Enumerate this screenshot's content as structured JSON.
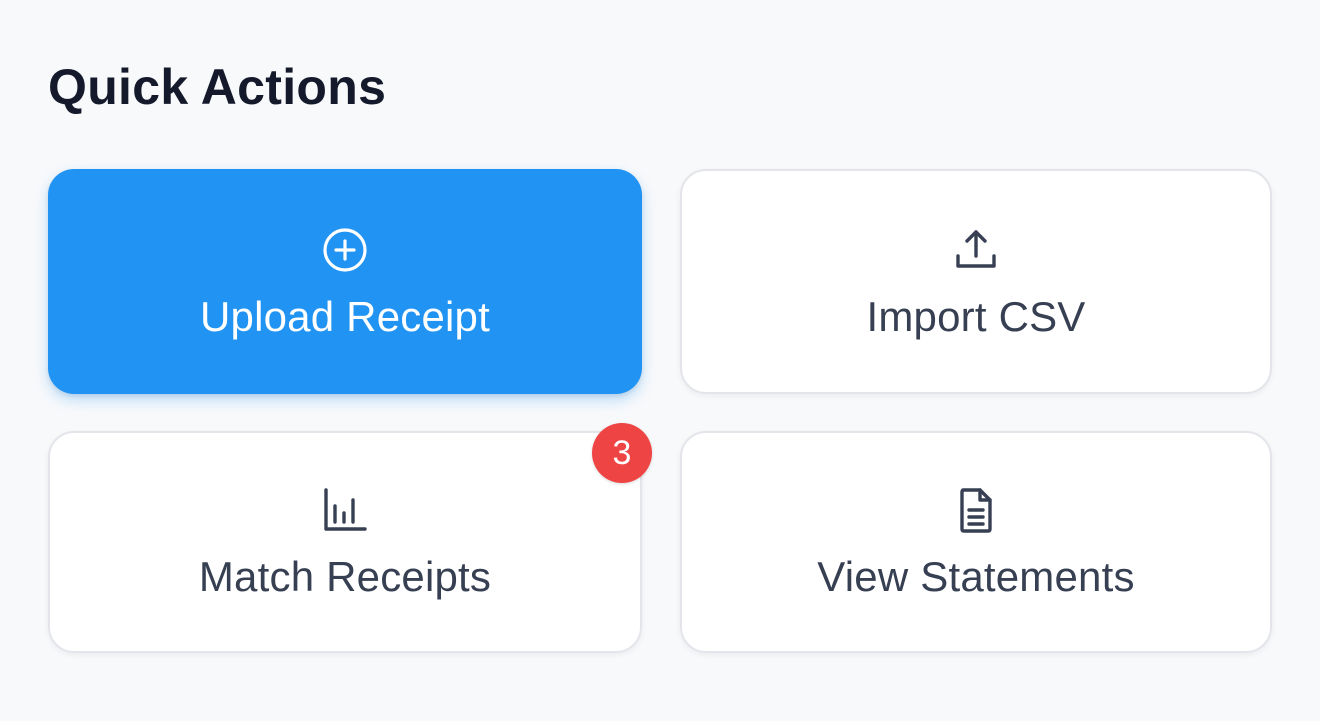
{
  "quick_actions": {
    "title": "Quick Actions",
    "tiles": [
      {
        "label": "Upload Receipt",
        "icon": "plus-circle-icon",
        "primary": true
      },
      {
        "label": "Import CSV",
        "icon": "upload-icon",
        "primary": false
      },
      {
        "label": "Match Receipts",
        "icon": "bar-chart-icon",
        "primary": false,
        "badge": "3"
      },
      {
        "label": "View Statements",
        "icon": "document-icon",
        "primary": false
      }
    ]
  },
  "colors": {
    "primary": "#2194f3",
    "badge": "#ef4444",
    "text_dark": "#141a2b",
    "text_muted": "#374052",
    "background": "#f8f9fb"
  }
}
